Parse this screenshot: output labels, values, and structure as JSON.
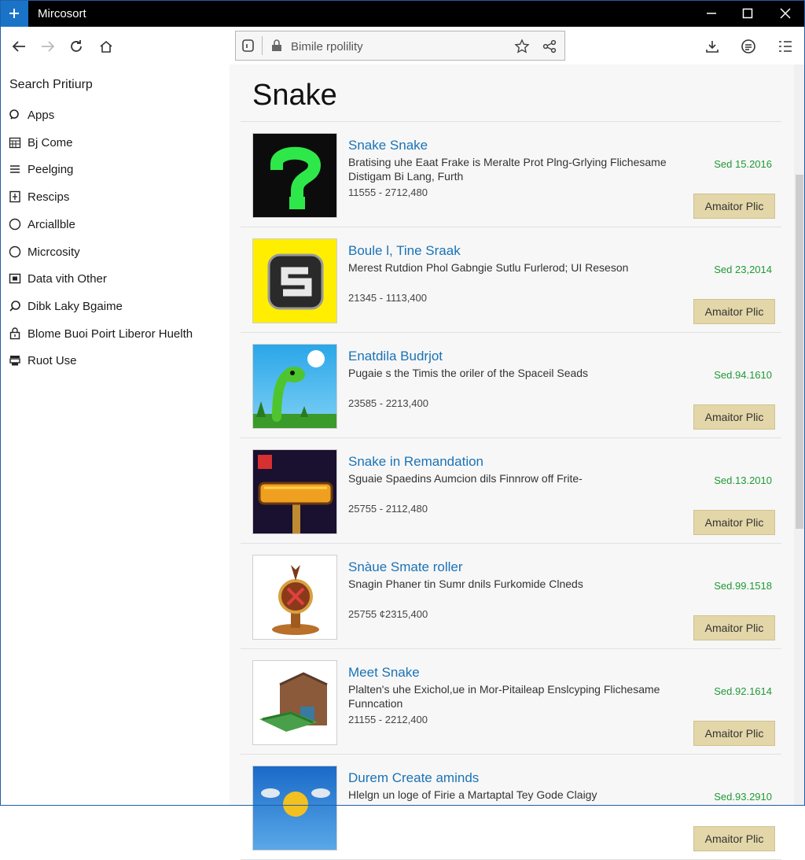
{
  "window": {
    "title": "Mircosort"
  },
  "address": {
    "text": "Bimile rpolility"
  },
  "sidebar": {
    "title": "Search Pritiurp",
    "items": [
      {
        "label": "Apps",
        "icon": "search-icon"
      },
      {
        "label": "Bj Come",
        "icon": "calendar-icon"
      },
      {
        "label": "Peelging",
        "icon": "list-icon"
      },
      {
        "label": "Rescips",
        "icon": "document-icon"
      },
      {
        "label": "Arciallble",
        "icon": "circle-icon"
      },
      {
        "label": "Micrcosity",
        "icon": "circle-icon"
      },
      {
        "label": "Data vith Other",
        "icon": "tile-icon"
      },
      {
        "label": "Dibk Laky Bgaime",
        "icon": "search-icon"
      },
      {
        "label": "Blome Buoi Poirt Liberor Huelth",
        "icon": "lock-icon"
      },
      {
        "label": "Ruot Use",
        "icon": "printer-icon"
      }
    ]
  },
  "main": {
    "title": "Snake",
    "apps": [
      {
        "name": "Snake Snake",
        "desc": "Bratising uhe Eaat Frake is Meralte Prot Plng-Grlying Flichesame Distigam Bi Lang, Furth",
        "meta": "11555 - 2712,480",
        "date": "Sed 15.2016",
        "button": "Amaitor Plic",
        "thumb": "question-thumb"
      },
      {
        "name": "Boule l, Tine Sraak",
        "desc": "Merest Rutdion Phol Gabngie Sutlu Furlerod; UI Reseson",
        "meta": "21345 - 1113,400",
        "date": "Sed 23,2014",
        "button": "Amaitor Plic",
        "thumb": "snake-s-thumb"
      },
      {
        "name": "Enatdila Budrjot",
        "desc": "Pugaie s the Timis the oriler of the Spaceil Seads",
        "meta": "23585 - 2213,400",
        "date": "Sed.94.1610",
        "button": "Amaitor Plic",
        "thumb": "green-snake-thumb"
      },
      {
        "name": "Snake in Remandation",
        "desc": "Sguaie Spaedins Aumcion dils Finnrow off Frite-",
        "meta": "25755 - 2112,480",
        "date": "Sed.13.2010",
        "button": "Amaitor Plic",
        "thumb": "snake-logo-thumb"
      },
      {
        "name": "Snàue Smate roller",
        "desc": "Snagin Phaner tin Sumr dnils Furkomide Clneds",
        "meta": "25755 ¢2315,400",
        "date": "Sed.99.1518",
        "button": "Amaitor Plic",
        "thumb": "trophy-thumb"
      },
      {
        "name": "Meet Snake",
        "desc": "Plalten's uhe Exichol,ue in Mor-Pitaileap Enslcyping Flichesame Funncation",
        "meta": "21155 - 2212,400",
        "date": "Sed.92.1614",
        "button": "Amaitor Plic",
        "thumb": "house-thumb"
      },
      {
        "name": "Durem Create aminds",
        "desc": "Hlelgn un loge of Firie a Martaptal Tey Gode Claigy",
        "meta": "",
        "date": "Sed.93.2910",
        "button": "Amaitor Plic",
        "thumb": "sky-thumb"
      }
    ]
  }
}
